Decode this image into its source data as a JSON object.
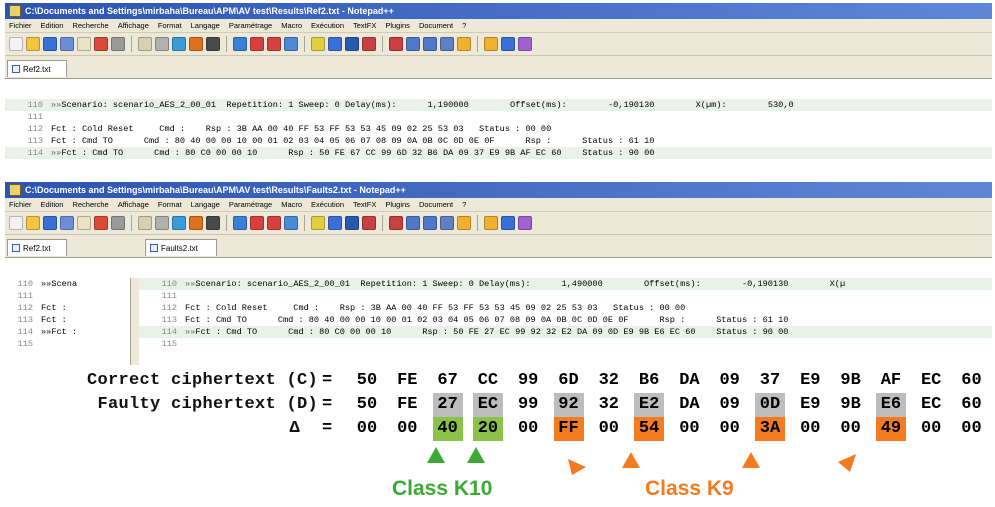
{
  "windows": [
    {
      "title": "C:\\Documents and Settings\\mirbaha\\Bureau\\APM\\AV test\\Results\\Ref2.txt - Notepad++",
      "tabs": [
        {
          "label": "Ref2.txt"
        }
      ],
      "lines": [
        {
          "num": "110",
          "arrow": "»»",
          "text": "Scenario: scenario_AES_2_00_01  Repetition: 1 Sweep: 0 Delay(ms):      1,190000        Offset(ms):        -0,190130        X(µm):        530,0"
        },
        {
          "num": "111",
          "arrow": "",
          "text": ""
        },
        {
          "num": "112",
          "arrow": "",
          "text": "Fct : Cold Reset     Cmd :    Rsp : 3B AA 00 40 FF 53 FF 53 53 45 09 02 25 53 03   Status : 00 00"
        },
        {
          "num": "113",
          "arrow": "",
          "text": "Fct : Cmd TO      Cmd : 80 40 00 00 10 00 01 02 03 04 05 06 07 08 09 0A 0B 0C 0D 0E 0F      Rsp :      Status : 61 10"
        },
        {
          "num": "114",
          "arrow": "»»",
          "text": "Fct : Cmd TO      Cmd : 80 C0 00 00 10      Rsp : 50 FE 67 CC 99 6D 32 B6 DA 09 37 E9 9B AF EC 60    Status : 90 00"
        }
      ]
    },
    {
      "title": "C:\\Documents and Settings\\mirbaha\\Bureau\\APM\\AV test\\Results\\Faults2.txt - Notepad++",
      "tabs": [
        {
          "label": "Ref2.txt"
        },
        {
          "label": "Faults2.txt"
        }
      ],
      "left_lines": [
        {
          "num": "110",
          "text": "»»Scena"
        },
        {
          "num": "111",
          "text": ""
        },
        {
          "num": "112",
          "text": "Fct :"
        },
        {
          "num": "113",
          "text": "Fct :"
        },
        {
          "num": "114",
          "text": "»»Fct :"
        },
        {
          "num": "115",
          "text": ""
        }
      ],
      "lines": [
        {
          "num": "110",
          "arrow": "»»",
          "text": "Scenario: scenario_AES_2_00_01  Repetition: 1 Sweep: 0 Delay(ms):      1,490000        Offset(ms):        -0,190130        X(µ"
        },
        {
          "num": "111",
          "arrow": "",
          "text": ""
        },
        {
          "num": "112",
          "arrow": "",
          "text": "Fct : Cold Reset     Cmd :    Rsp : 3B AA 00 40 FF 53 FF 53 53 45 09 02 25 53 03   Status : 00 00"
        },
        {
          "num": "113",
          "arrow": "",
          "text": "Fct : Cmd TO      Cmd : 80 40 00 00 10 00 01 02 03 04 05 06 07 08 09 0A 0B 0C 0D 0E 0F      Rsp :      Status : 61 10"
        },
        {
          "num": "114",
          "arrow": "»»",
          "text": "Fct : Cmd TO      Cmd : 80 C0 00 00 10      Rsp : 50 FE 27 EC 99 92 32 E2 DA 09 0D E9 9B E6 EC 60    Status : 90 00"
        },
        {
          "num": "115",
          "arrow": "",
          "text": ""
        }
      ]
    }
  ],
  "menu": [
    "Fichier",
    "Edition",
    "Recherche",
    "Affichage",
    "Format",
    "Langage",
    "Paramétrage",
    "Macro",
    "Exécution",
    "TextFX",
    "Plugins",
    "Document",
    "?"
  ],
  "analysis": {
    "rows": [
      {
        "label": "Correct ciphertext (C)",
        "eq": "=",
        "bytes": [
          "50",
          "FE",
          "67",
          "CC",
          "99",
          "6D",
          "32",
          "B6",
          "DA",
          "09",
          "37",
          "E9",
          "9B",
          "AF",
          "EC",
          "60"
        ],
        "hl": [
          "",
          "",
          "",
          "",
          "",
          "",
          "",
          "",
          "",
          "",
          "",
          "",
          "",
          "",
          "",
          ""
        ]
      },
      {
        "label": "Faulty ciphertext (D)",
        "eq": "=",
        "bytes": [
          "50",
          "FE",
          "27",
          "EC",
          "99",
          "92",
          "32",
          "E2",
          "DA",
          "09",
          "0D",
          "E9",
          "9B",
          "E6",
          "EC",
          "60"
        ],
        "hl": [
          "",
          "",
          "grey",
          "grey",
          "",
          "grey",
          "",
          "grey",
          "",
          "",
          "grey",
          "",
          "",
          "grey",
          "",
          ""
        ]
      },
      {
        "label": "Δ",
        "eq": "=",
        "bytes": [
          "00",
          "00",
          "40",
          "20",
          "00",
          "FF",
          "00",
          "54",
          "00",
          "00",
          "3A",
          "00",
          "00",
          "49",
          "00",
          "00"
        ],
        "hl": [
          "",
          "",
          "green",
          "green",
          "",
          "orange",
          "",
          "orange",
          "",
          "",
          "orange",
          "",
          "",
          "orange",
          "",
          ""
        ]
      }
    ],
    "class_k10": "Class K10",
    "class_k9": "Class K9",
    "colors": {
      "green": "#3aa935",
      "orange": "#f47b20",
      "grey": "#bdbdbd",
      "green_fill": "#8bc34a"
    }
  }
}
